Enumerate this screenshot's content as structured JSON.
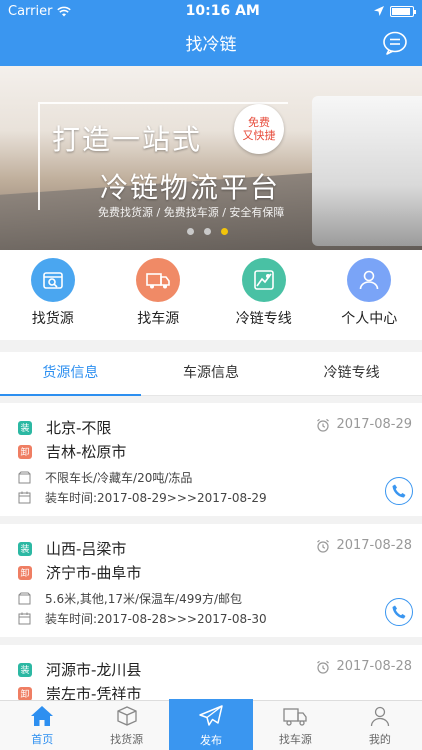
{
  "status_bar": {
    "carrier": "Carrier",
    "time": "10:16 AM"
  },
  "nav": {
    "title": "找冷链",
    "message_icon": "chat-bubble-icon"
  },
  "banner": {
    "line1": "打造一站式",
    "line2": "冷链物流平台",
    "subtitle": "免费找货源 / 免费找车源 / 安全有保障",
    "badge_line1": "免费",
    "badge_line2": "又快捷",
    "page_count": 3,
    "active_page": 3
  },
  "quick_actions": [
    {
      "label": "找货源",
      "icon": "cargo-search-icon",
      "color": "#4aa6f0"
    },
    {
      "label": "找车源",
      "icon": "truck-icon",
      "color": "#f08a66"
    },
    {
      "label": "冷链专线",
      "icon": "map-route-icon",
      "color": "#49c1a4"
    },
    {
      "label": "个人中心",
      "icon": "user-icon",
      "color": "#7aa4f7"
    }
  ],
  "tabs": [
    {
      "label": "货源信息",
      "active": true
    },
    {
      "label": "车源信息",
      "active": false
    },
    {
      "label": "冷链专线",
      "active": false
    }
  ],
  "badges": {
    "load": "装",
    "unload": "卸"
  },
  "listings": [
    {
      "load": "北京-不限",
      "unload": "吉林-松原市",
      "date": "2017-08-29",
      "detail": "不限车长/冷藏车/20吨/冻品",
      "time": "装车时间:2017-08-29>>>2017-08-29"
    },
    {
      "load": "山西-吕梁市",
      "unload": "济宁市-曲阜市",
      "date": "2017-08-28",
      "detail": "5.6米,其他,17米/保温车/499方/邮包",
      "time": "装车时间:2017-08-28>>>2017-08-30"
    },
    {
      "load": "河源市-龙川县",
      "unload": "崇左市-凭祥市",
      "date": "2017-08-28"
    }
  ],
  "tab_bar": [
    {
      "label": "首页",
      "icon": "home-icon",
      "active": true
    },
    {
      "label": "找货源",
      "icon": "box-icon",
      "active": false
    },
    {
      "label": "发布",
      "icon": "paper-plane-icon",
      "active": false
    },
    {
      "label": "找车源",
      "icon": "truck-icon",
      "active": false
    },
    {
      "label": "我的",
      "icon": "person-icon",
      "active": false
    }
  ],
  "colors": {
    "primary": "#3a96f0",
    "load_badge": "#2cb8a3",
    "unload_badge": "#ef7e63",
    "dot_active": "#f2c40a"
  }
}
